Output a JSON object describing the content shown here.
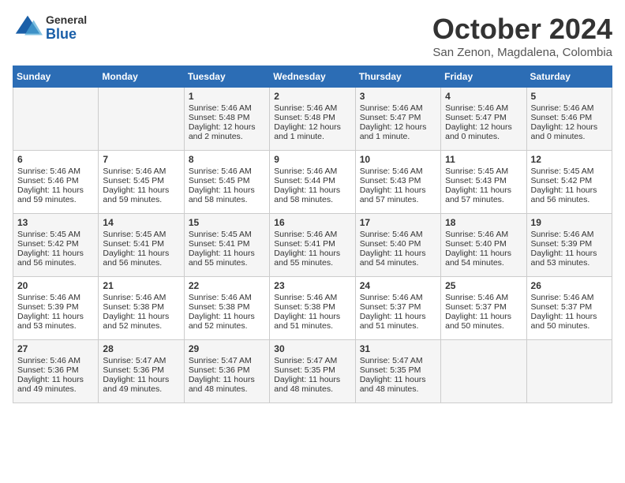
{
  "header": {
    "logo": {
      "general": "General",
      "blue": "Blue"
    },
    "month": "October 2024",
    "location": "San Zenon, Magdalena, Colombia"
  },
  "weekdays": [
    "Sunday",
    "Monday",
    "Tuesday",
    "Wednesday",
    "Thursday",
    "Friday",
    "Saturday"
  ],
  "weeks": [
    [
      {
        "day": "",
        "content": ""
      },
      {
        "day": "",
        "content": ""
      },
      {
        "day": "1",
        "sunrise": "5:46 AM",
        "sunset": "5:48 PM",
        "daylight": "12 hours and 2 minutes."
      },
      {
        "day": "2",
        "sunrise": "5:46 AM",
        "sunset": "5:48 PM",
        "daylight": "12 hours and 1 minute."
      },
      {
        "day": "3",
        "sunrise": "5:46 AM",
        "sunset": "5:47 PM",
        "daylight": "12 hours and 1 minute."
      },
      {
        "day": "4",
        "sunrise": "5:46 AM",
        "sunset": "5:47 PM",
        "daylight": "12 hours and 0 minutes."
      },
      {
        "day": "5",
        "sunrise": "5:46 AM",
        "sunset": "5:46 PM",
        "daylight": "12 hours and 0 minutes."
      }
    ],
    [
      {
        "day": "6",
        "sunrise": "5:46 AM",
        "sunset": "5:46 PM",
        "daylight": "11 hours and 59 minutes."
      },
      {
        "day": "7",
        "sunrise": "5:46 AM",
        "sunset": "5:45 PM",
        "daylight": "11 hours and 59 minutes."
      },
      {
        "day": "8",
        "sunrise": "5:46 AM",
        "sunset": "5:45 PM",
        "daylight": "11 hours and 58 minutes."
      },
      {
        "day": "9",
        "sunrise": "5:46 AM",
        "sunset": "5:44 PM",
        "daylight": "11 hours and 58 minutes."
      },
      {
        "day": "10",
        "sunrise": "5:46 AM",
        "sunset": "5:43 PM",
        "daylight": "11 hours and 57 minutes."
      },
      {
        "day": "11",
        "sunrise": "5:45 AM",
        "sunset": "5:43 PM",
        "daylight": "11 hours and 57 minutes."
      },
      {
        "day": "12",
        "sunrise": "5:45 AM",
        "sunset": "5:42 PM",
        "daylight": "11 hours and 56 minutes."
      }
    ],
    [
      {
        "day": "13",
        "sunrise": "5:45 AM",
        "sunset": "5:42 PM",
        "daylight": "11 hours and 56 minutes."
      },
      {
        "day": "14",
        "sunrise": "5:45 AM",
        "sunset": "5:41 PM",
        "daylight": "11 hours and 56 minutes."
      },
      {
        "day": "15",
        "sunrise": "5:45 AM",
        "sunset": "5:41 PM",
        "daylight": "11 hours and 55 minutes."
      },
      {
        "day": "16",
        "sunrise": "5:46 AM",
        "sunset": "5:41 PM",
        "daylight": "11 hours and 55 minutes."
      },
      {
        "day": "17",
        "sunrise": "5:46 AM",
        "sunset": "5:40 PM",
        "daylight": "11 hours and 54 minutes."
      },
      {
        "day": "18",
        "sunrise": "5:46 AM",
        "sunset": "5:40 PM",
        "daylight": "11 hours and 54 minutes."
      },
      {
        "day": "19",
        "sunrise": "5:46 AM",
        "sunset": "5:39 PM",
        "daylight": "11 hours and 53 minutes."
      }
    ],
    [
      {
        "day": "20",
        "sunrise": "5:46 AM",
        "sunset": "5:39 PM",
        "daylight": "11 hours and 53 minutes."
      },
      {
        "day": "21",
        "sunrise": "5:46 AM",
        "sunset": "5:38 PM",
        "daylight": "11 hours and 52 minutes."
      },
      {
        "day": "22",
        "sunrise": "5:46 AM",
        "sunset": "5:38 PM",
        "daylight": "11 hours and 52 minutes."
      },
      {
        "day": "23",
        "sunrise": "5:46 AM",
        "sunset": "5:38 PM",
        "daylight": "11 hours and 51 minutes."
      },
      {
        "day": "24",
        "sunrise": "5:46 AM",
        "sunset": "5:37 PM",
        "daylight": "11 hours and 51 minutes."
      },
      {
        "day": "25",
        "sunrise": "5:46 AM",
        "sunset": "5:37 PM",
        "daylight": "11 hours and 50 minutes."
      },
      {
        "day": "26",
        "sunrise": "5:46 AM",
        "sunset": "5:37 PM",
        "daylight": "11 hours and 50 minutes."
      }
    ],
    [
      {
        "day": "27",
        "sunrise": "5:46 AM",
        "sunset": "5:36 PM",
        "daylight": "11 hours and 49 minutes."
      },
      {
        "day": "28",
        "sunrise": "5:47 AM",
        "sunset": "5:36 PM",
        "daylight": "11 hours and 49 minutes."
      },
      {
        "day": "29",
        "sunrise": "5:47 AM",
        "sunset": "5:36 PM",
        "daylight": "11 hours and 48 minutes."
      },
      {
        "day": "30",
        "sunrise": "5:47 AM",
        "sunset": "5:35 PM",
        "daylight": "11 hours and 48 minutes."
      },
      {
        "day": "31",
        "sunrise": "5:47 AM",
        "sunset": "5:35 PM",
        "daylight": "11 hours and 48 minutes."
      },
      {
        "day": "",
        "content": ""
      },
      {
        "day": "",
        "content": ""
      }
    ]
  ],
  "labels": {
    "sunrise": "Sunrise:",
    "sunset": "Sunset:",
    "daylight": "Daylight:"
  }
}
